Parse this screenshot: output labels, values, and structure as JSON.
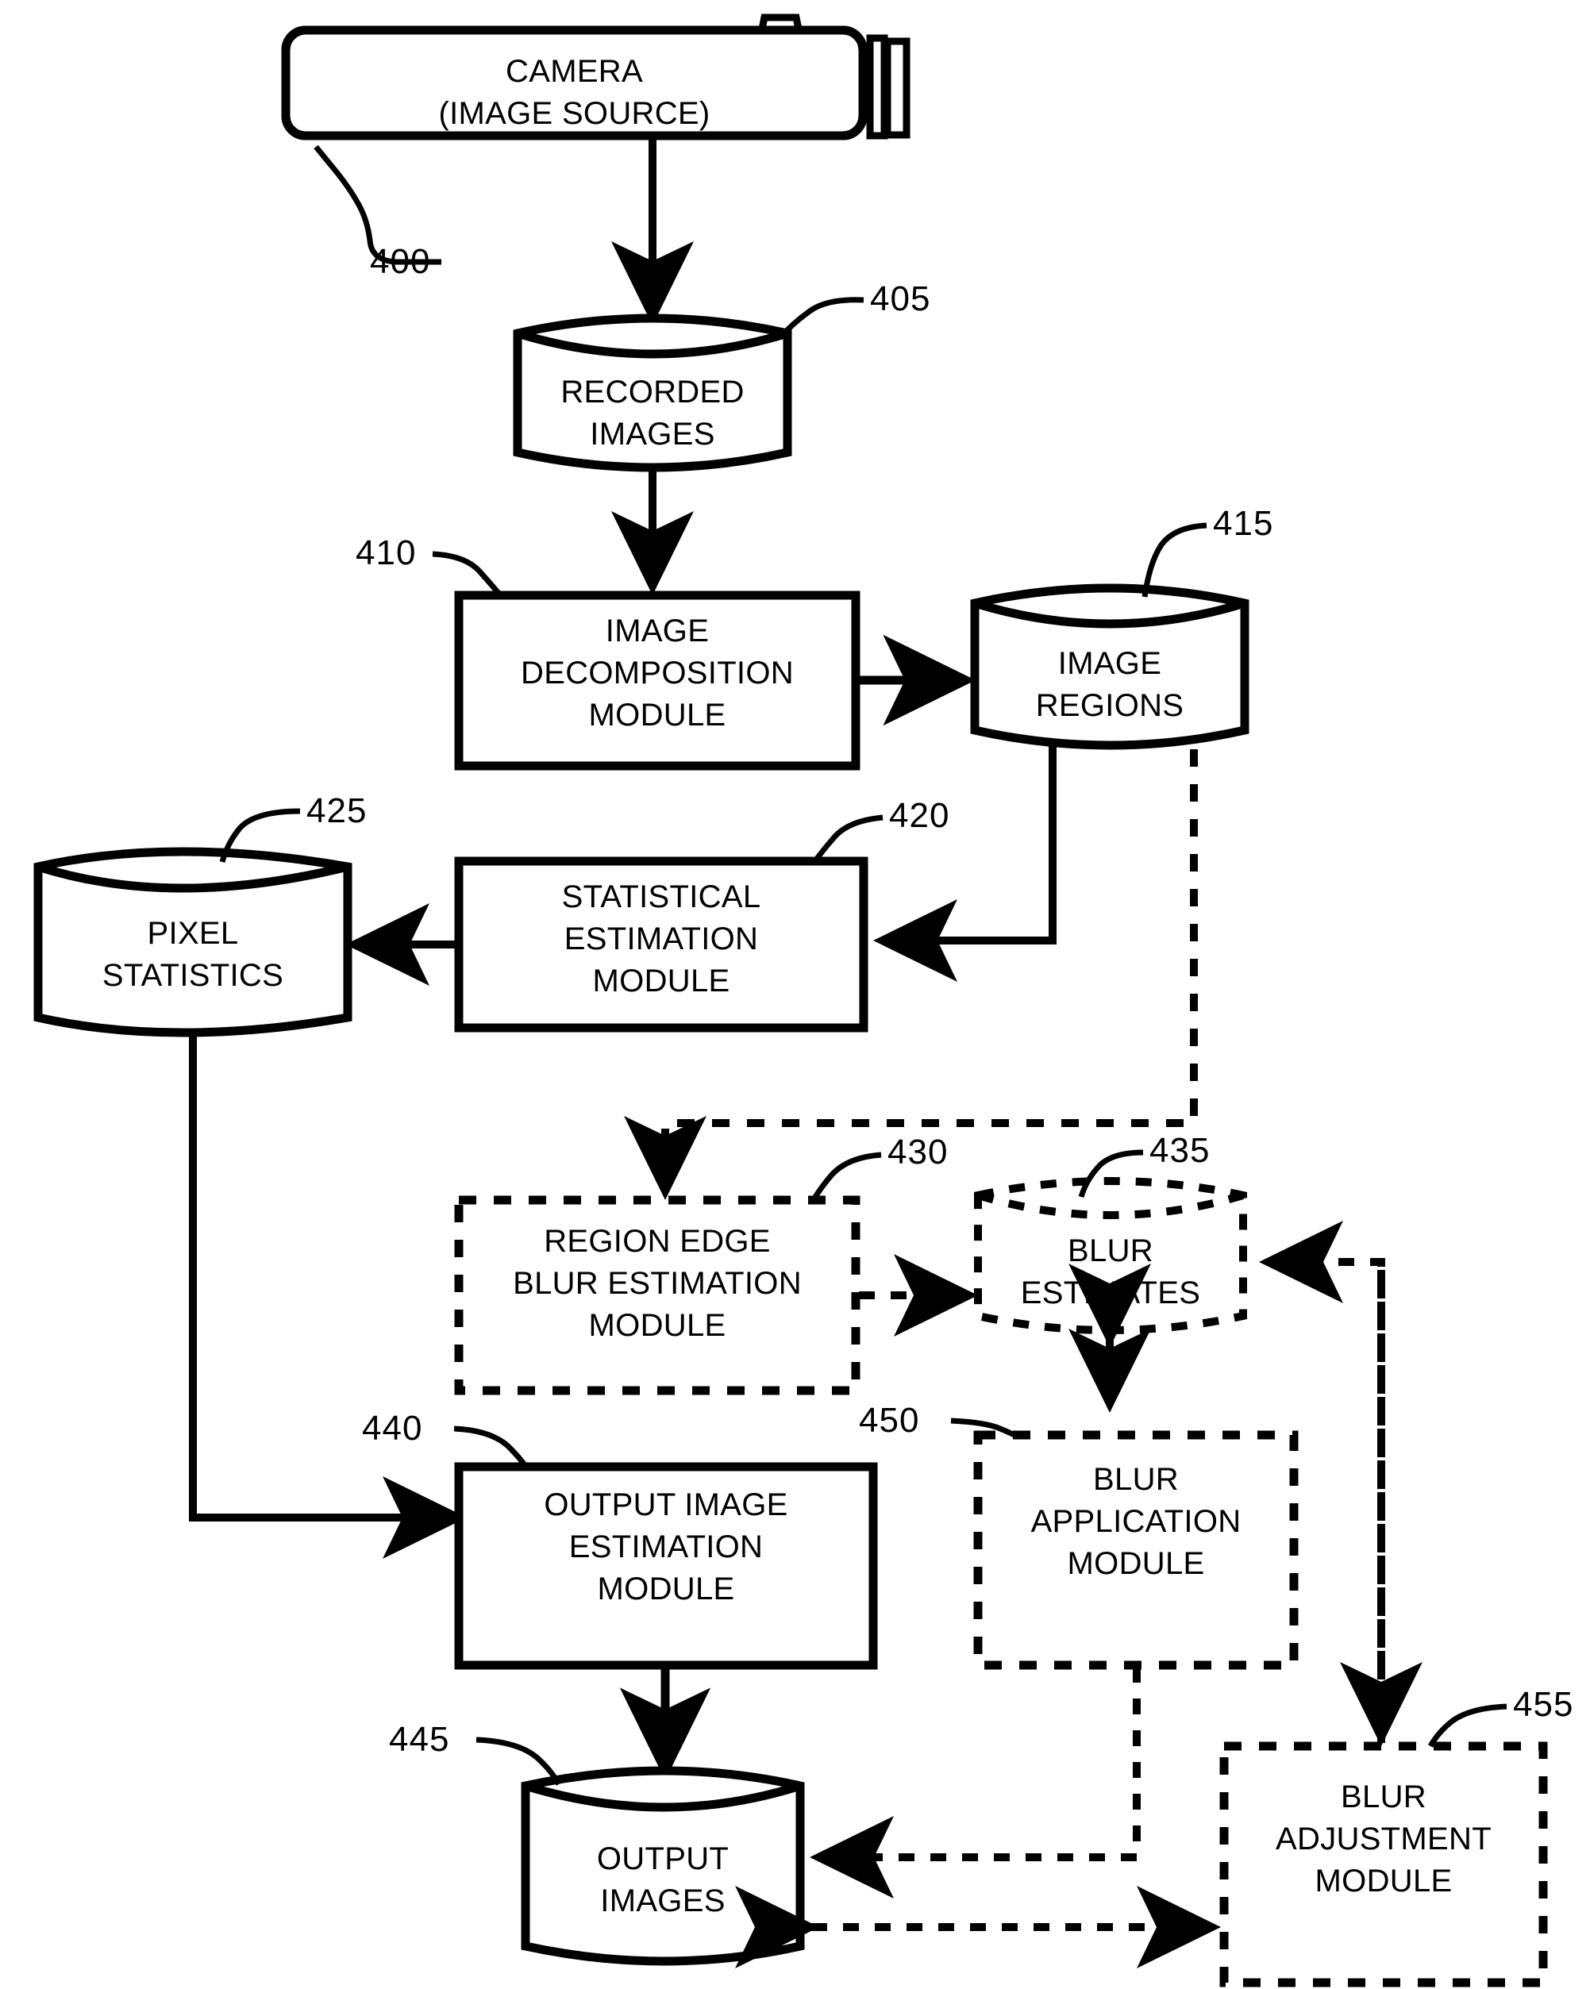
{
  "figure": {
    "type": "patent-flow-diagram",
    "background": "#ffffff",
    "stroke_color": "#000000"
  },
  "nodes": {
    "camera": {
      "label": "CAMERA\n(IMAGE SOURCE)",
      "ref": "400",
      "shape": "camera-body",
      "style": "solid"
    },
    "recorded_images": {
      "label": "RECORDED\nIMAGES",
      "ref": "405",
      "shape": "cylinder",
      "style": "solid"
    },
    "image_decomposition": {
      "label": "IMAGE\nDECOMPOSITION\nMODULE",
      "ref": "410",
      "shape": "rectangle",
      "style": "solid"
    },
    "image_regions": {
      "label": "IMAGE\nREGIONS",
      "ref": "415",
      "shape": "cylinder",
      "style": "solid"
    },
    "statistical_estimation": {
      "label": "STATISTICAL\nESTIMATION\nMODULE",
      "ref": "420",
      "shape": "rectangle",
      "style": "solid"
    },
    "pixel_statistics": {
      "label": "PIXEL\nSTATISTICS",
      "ref": "425",
      "shape": "cylinder",
      "style": "solid"
    },
    "region_edge_blur": {
      "label": "REGION EDGE\nBLUR ESTIMATION\nMODULE",
      "ref": "430",
      "shape": "rectangle",
      "style": "dashed"
    },
    "blur_estimates": {
      "label": "BLUR\nESTIMATES",
      "ref": "435",
      "shape": "cylinder",
      "style": "dashed"
    },
    "output_image_estimation": {
      "label": "OUTPUT IMAGE\nESTIMATION\nMODULE",
      "ref": "440",
      "shape": "rectangle",
      "style": "solid"
    },
    "output_images": {
      "label": "OUTPUT\nIMAGES",
      "ref": "445",
      "shape": "cylinder",
      "style": "solid"
    },
    "blur_application": {
      "label": "BLUR\nAPPLICATION\nMODULE",
      "ref": "450",
      "shape": "rectangle",
      "style": "dashed"
    },
    "blur_adjustment": {
      "label": "BLUR\nADJUSTMENT\nMODULE",
      "ref": "455",
      "shape": "rectangle",
      "style": "dashed"
    }
  },
  "edges": [
    {
      "from": "camera",
      "to": "recorded_images",
      "style": "solid",
      "arrows": "end"
    },
    {
      "from": "recorded_images",
      "to": "image_decomposition",
      "style": "solid",
      "arrows": "end"
    },
    {
      "from": "image_decomposition",
      "to": "image_regions",
      "style": "solid",
      "arrows": "end"
    },
    {
      "from": "image_regions",
      "to": "statistical_estimation",
      "style": "solid",
      "arrows": "end"
    },
    {
      "from": "statistical_estimation",
      "to": "pixel_statistics",
      "style": "solid",
      "arrows": "end"
    },
    {
      "from": "image_regions",
      "to": "region_edge_blur",
      "style": "dashed",
      "arrows": "end"
    },
    {
      "from": "region_edge_blur",
      "to": "blur_estimates",
      "style": "dashed",
      "arrows": "end"
    },
    {
      "from": "pixel_statistics",
      "to": "output_image_estimation",
      "style": "solid",
      "arrows": "end"
    },
    {
      "from": "output_image_estimation",
      "to": "output_images",
      "style": "solid",
      "arrows": "end"
    },
    {
      "from": "blur_estimates",
      "to": "blur_application",
      "style": "dashed",
      "arrows": "both"
    },
    {
      "from": "blur_application",
      "to": "output_images",
      "style": "dashed",
      "arrows": "end"
    },
    {
      "from": "output_images",
      "to": "blur_adjustment",
      "style": "dashed",
      "arrows": "both"
    },
    {
      "from": "blur_adjustment",
      "to": "blur_estimates",
      "style": "dashed",
      "arrows": "end"
    }
  ],
  "reference_numerals": [
    "400",
    "405",
    "410",
    "415",
    "420",
    "425",
    "430",
    "435",
    "440",
    "445",
    "450",
    "455"
  ]
}
